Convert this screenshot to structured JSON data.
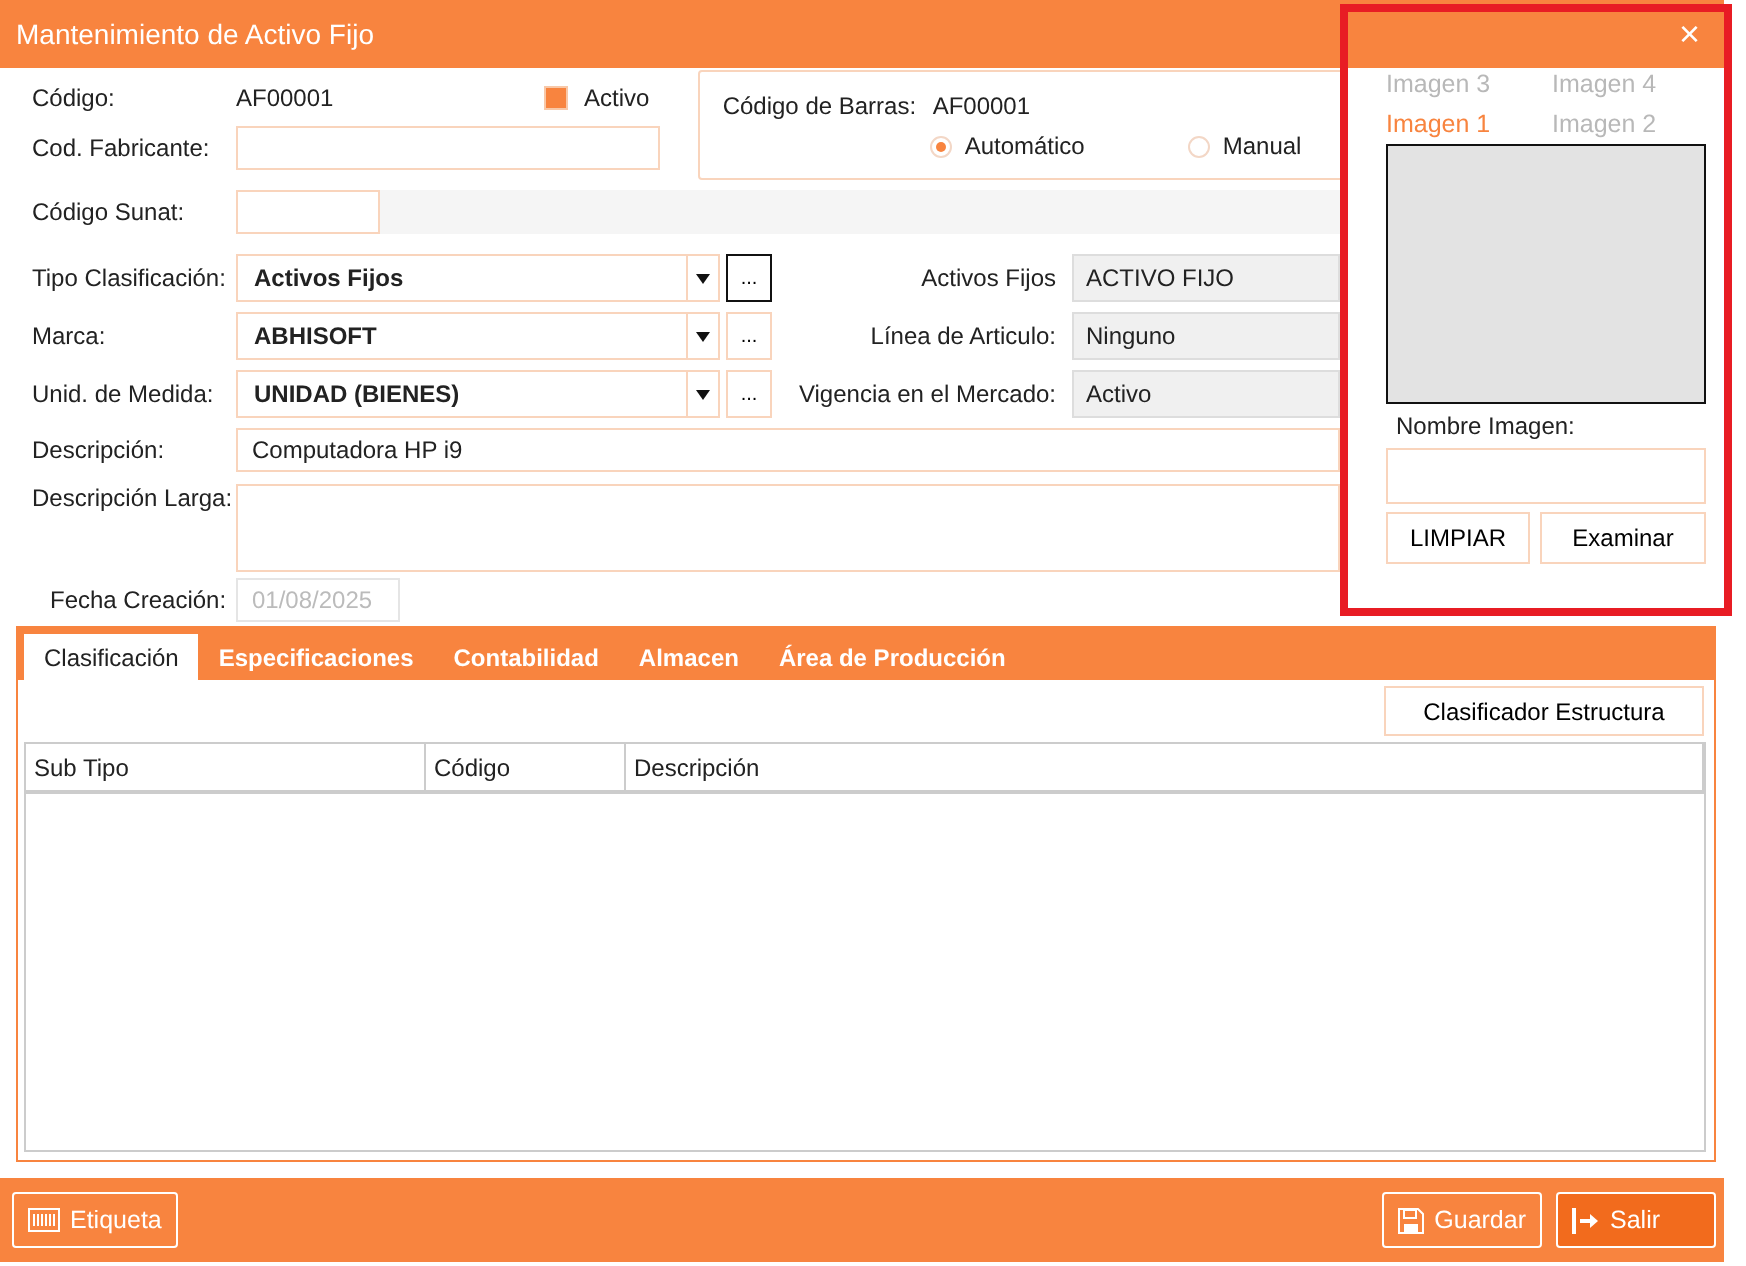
{
  "window": {
    "title": "Mantenimiento de Activo Fijo",
    "close": "×"
  },
  "codigo": {
    "label": "Código:",
    "value": "AF00001"
  },
  "activo": {
    "label": "Activo",
    "checked": true
  },
  "fabricante": {
    "label": "Cod. Fabricante:"
  },
  "sunat": {
    "label": "Código Sunat:"
  },
  "barcode": {
    "label": "Código de Barras:",
    "value": "AF00001",
    "options": [
      {
        "label": "Automático",
        "selected": true
      },
      {
        "label": "Manual",
        "selected": false
      }
    ]
  },
  "combos": [
    {
      "label": "Tipo Clasificación:",
      "value": "Activos Fijos",
      "more": "...",
      "focused": true
    },
    {
      "label": "Marca:",
      "value": "ABHISOFT",
      "more": "...",
      "focused": false
    },
    {
      "label": "Unid. de Medida:",
      "value": "UNIDAD (BIENES)",
      "more": "...",
      "focused": false
    }
  ],
  "side_combos": [
    {
      "label": "Activos Fijos",
      "value": "ACTIVO FIJO"
    },
    {
      "label": "Línea de Articulo:",
      "value": "Ninguno"
    },
    {
      "label": "Vigencia en el Mercado:",
      "value": "Activo"
    }
  ],
  "descripcion": {
    "label": "Descripción:",
    "value": "Computadora HP i9"
  },
  "descripcion_larga": {
    "label": "Descripción Larga:"
  },
  "fecha": {
    "label": "Fecha Creación:",
    "value": "01/08/2025",
    "disabled": true
  },
  "image_panel": {
    "tabs": [
      {
        "label": "Imagen 3",
        "selected": false
      },
      {
        "label": "Imagen 4",
        "selected": false
      },
      {
        "label": "Imagen 1",
        "selected": true
      },
      {
        "label": "Imagen 2",
        "selected": false
      }
    ],
    "name_label": "Nombre Imagen:",
    "buttons": [
      "LIMPIAR",
      "Examinar"
    ]
  },
  "tabs": [
    {
      "label": "Clasificación",
      "selected": true
    },
    {
      "label": "Especificaciones",
      "selected": false
    },
    {
      "label": "Contabilidad",
      "selected": false
    },
    {
      "label": "Almacen",
      "selected": false
    },
    {
      "label": "Área de Producción",
      "selected": false
    }
  ],
  "structure_button": "Clasificador Estructura",
  "table": {
    "columns": [
      "Sub Tipo",
      "Código",
      "Descripción"
    ]
  },
  "footer": {
    "left": [
      {
        "label": "Etiqueta",
        "kind": "barcode"
      }
    ],
    "right": [
      {
        "label": "Guardar",
        "kind": "save"
      },
      {
        "label": "Salir",
        "kind": "exit"
      }
    ]
  }
}
